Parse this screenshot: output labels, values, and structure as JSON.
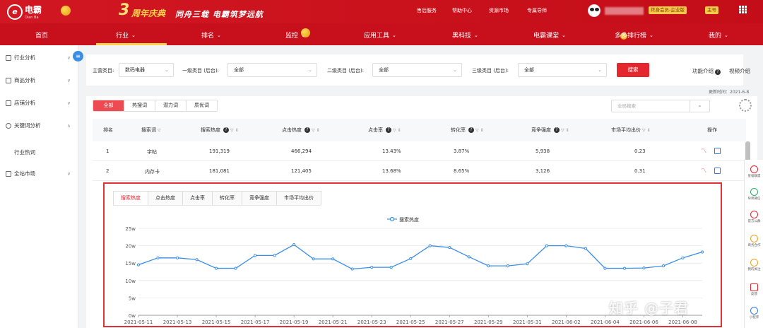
{
  "header": {
    "logo_main": "电霸",
    "logo_sub": "Dian Ba",
    "anniv_number": "3",
    "anniv_title": "周年庆典",
    "anniv_slogan": "同舟三载 电霸筑梦远航",
    "links": [
      "售后服务",
      "帮助中心",
      "资源市场",
      "专属导师"
    ],
    "member_badge": "终身会员-企业版",
    "account_badge": "主号"
  },
  "nav": {
    "items": [
      {
        "label": "首页",
        "chevron": false
      },
      {
        "label": "行业",
        "chevron": true
      },
      {
        "label": "排名",
        "chevron": true
      },
      {
        "label": "监控",
        "chevron": true
      },
      {
        "label": "应用工具",
        "chevron": true
      },
      {
        "label": "黑科技",
        "chevron": true
      },
      {
        "label": "电霸课堂",
        "chevron": true
      },
      {
        "label": "多多排行榜",
        "chevron": true
      },
      {
        "label": "我的",
        "chevron": true
      }
    ]
  },
  "sidebar": {
    "items": [
      {
        "label": "行业分析",
        "icon": "grid-icon",
        "chevron": "∨"
      },
      {
        "label": "商品分析",
        "icon": "box-icon",
        "chevron": "∨"
      },
      {
        "label": "店铺分析",
        "icon": "store-icon",
        "chevron": "∨"
      },
      {
        "label": "关键词分析",
        "icon": "search-icon",
        "chevron": "∧"
      },
      {
        "label": "全站市场",
        "icon": "market-icon",
        "chevron": "∨"
      }
    ],
    "sub_item": "行业热词"
  },
  "filters": {
    "main_label": "主营类目:",
    "main_value": "数码电器",
    "lvl1_label": "一级类目 (后台):",
    "lvl1_value": "全部",
    "lvl2_label": "二级类目 (后台):",
    "lvl2_value": "全部",
    "lvl3_label": "三级类目 (后台):",
    "lvl3_value": "全部",
    "search_button": "搜索",
    "feature_intro": "功能介绍",
    "video_intro": "视频介绍"
  },
  "updated": "更新时间：2021-6-8",
  "word_tabs": [
    "全部",
    "热搜词",
    "潜力词",
    "质优词"
  ],
  "global_search_placeholder": "全局搜索",
  "table": {
    "columns": [
      "排名",
      "搜索词",
      "搜索热度",
      "点击热度",
      "点击率",
      "转化率",
      "竞争强度",
      "市场平均出价",
      "操作"
    ],
    "rows": [
      {
        "rank": "1",
        "word": "字帖",
        "search_heat": "191,319",
        "click_heat": "466,294",
        "ctr": "13.43%",
        "cvr": "3.87%",
        "competition": "5,938",
        "avg_bid": "0.23"
      },
      {
        "rank": "2",
        "word": "内存卡",
        "search_heat": "181,081",
        "click_heat": "121,405",
        "ctr": "13.68%",
        "cvr": "8.65%",
        "competition": "3,126",
        "avg_bid": "0.31"
      }
    ]
  },
  "chart_tabs": [
    "搜索热度",
    "点击热度",
    "点击率",
    "转化率",
    "竞争强度",
    "市场平均出价"
  ],
  "chart_data": {
    "type": "line",
    "title": "",
    "legend": "top-center",
    "series": [
      {
        "name": "搜索热度",
        "color": "#3a8ee6"
      }
    ],
    "x": [
      "2021-05-11",
      "2021-05-12",
      "2021-05-13",
      "2021-05-14",
      "2021-05-15",
      "2021-05-16",
      "2021-05-17",
      "2021-05-18",
      "2021-05-19",
      "2021-05-20",
      "2021-05-21",
      "2021-05-22",
      "2021-05-23",
      "2021-05-24",
      "2021-05-25",
      "2021-05-26",
      "2021-05-27",
      "2021-05-28",
      "2021-05-29",
      "2021-05-30",
      "2021-05-31",
      "2021-06-01",
      "2021-06-02",
      "2021-06-03",
      "2021-06-04",
      "2021-06-05",
      "2021-06-06",
      "2021-06-07",
      "2021-06-08"
    ],
    "x_tick_labels": [
      "2021-05-11",
      "2021-05-13",
      "2021-05-15",
      "2021-05-17",
      "2021-05-19",
      "2021-05-21",
      "2021-05-23",
      "2021-05-25",
      "2021-05-27",
      "2021-05-29",
      "2021-05-31",
      "2021-06-02",
      "2021-06-04",
      "2021-06-06",
      "2021-06-08"
    ],
    "values": [
      145000,
      165000,
      165000,
      160000,
      135000,
      135000,
      172000,
      172000,
      203000,
      162000,
      162000,
      133000,
      138000,
      138000,
      163000,
      200000,
      195000,
      168000,
      142000,
      142000,
      148000,
      200000,
      200000,
      192000,
      135000,
      135000,
      136000,
      142000,
      165000,
      182000
    ],
    "ylim": [
      0,
      250000
    ],
    "y_ticks": [
      "0w",
      "5w",
      "10w",
      "15w",
      "20w",
      "25w"
    ],
    "grid": true
  },
  "right_rail": [
    "星福联盟",
    "导师微信",
    "官方公群",
    "商务合作",
    "我的关注",
    "反馈",
    "小程序"
  ],
  "watermark": "知乎 @子君"
}
